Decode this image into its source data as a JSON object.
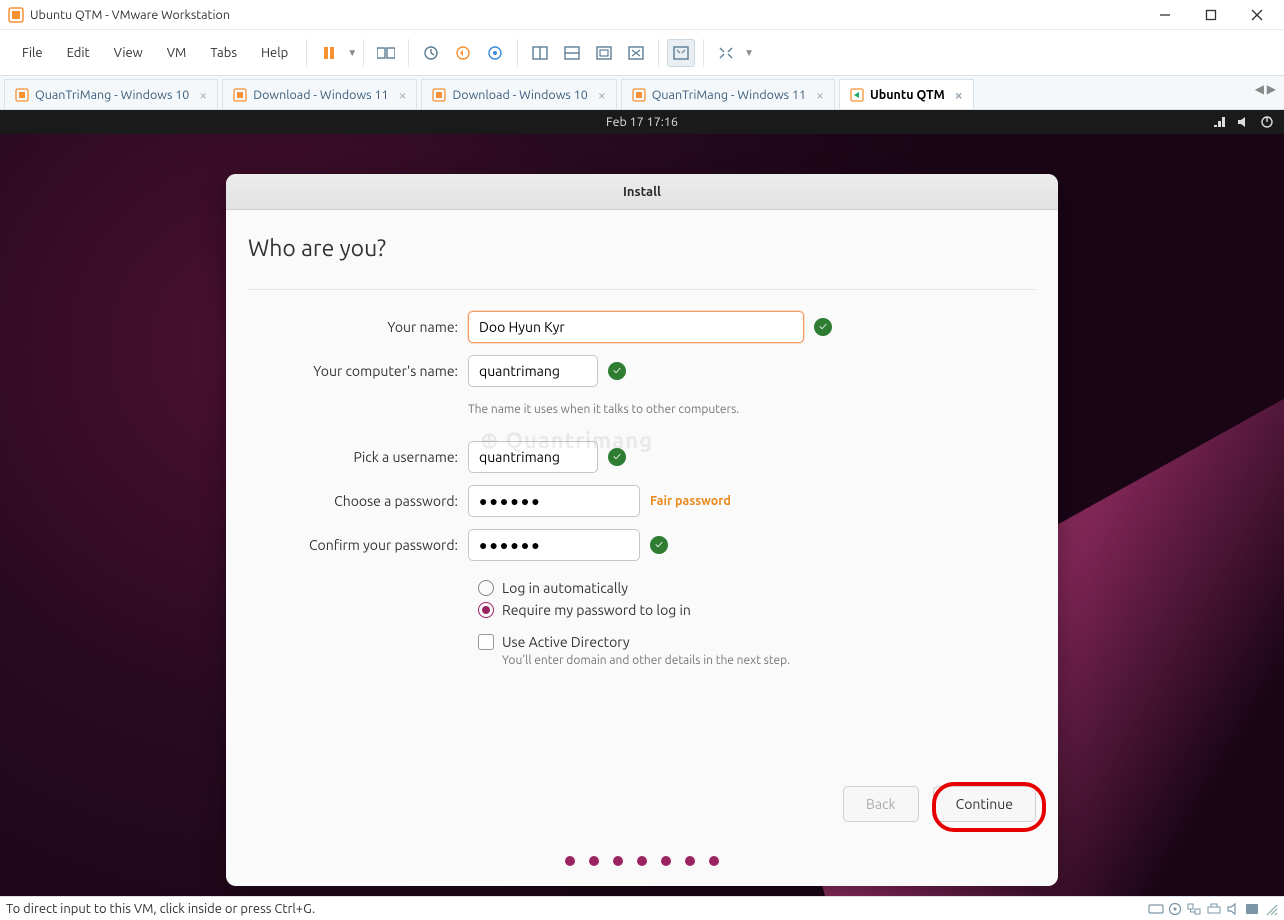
{
  "window": {
    "title": "Ubuntu QTM - VMware Workstation"
  },
  "menu": {
    "file": "File",
    "edit": "Edit",
    "view": "View",
    "vm": "VM",
    "tabs": "Tabs",
    "help": "Help"
  },
  "vmtabs": [
    {
      "label": "QuanTriMang - Windows 10",
      "active": false
    },
    {
      "label": "Download - Windows 11",
      "active": false
    },
    {
      "label": "Download - Windows 10",
      "active": false
    },
    {
      "label": "QuanTriMang - Windows 11",
      "active": false
    },
    {
      "label": "Ubuntu QTM",
      "active": true
    }
  ],
  "ubuntu_top": {
    "datetime": "Feb 17  17:16"
  },
  "dialog": {
    "header": "Install",
    "title": "Who are you?",
    "labels": {
      "name": "Your name:",
      "computer": "Your computer's name:",
      "computer_help": "The name it uses when it talks to other computers.",
      "username": "Pick a username:",
      "password": "Choose a password:",
      "confirm": "Confirm your password:"
    },
    "values": {
      "name": "Doo Hyun Kyr",
      "computer": "quantrimang",
      "username": "quantrimang",
      "password": "●●●●●●",
      "confirm": "●●●●●●",
      "pw_strength": "Fair password"
    },
    "options": {
      "auto_login": "Log in automatically",
      "require_pw": "Require my password to log in",
      "ad": "Use Active Directory",
      "ad_help": "You'll enter domain and other details in the next step."
    },
    "buttons": {
      "back": "Back",
      "continue": "Continue"
    }
  },
  "statusbar": {
    "hint": "To direct input to this VM, click inside or press Ctrl+G."
  }
}
